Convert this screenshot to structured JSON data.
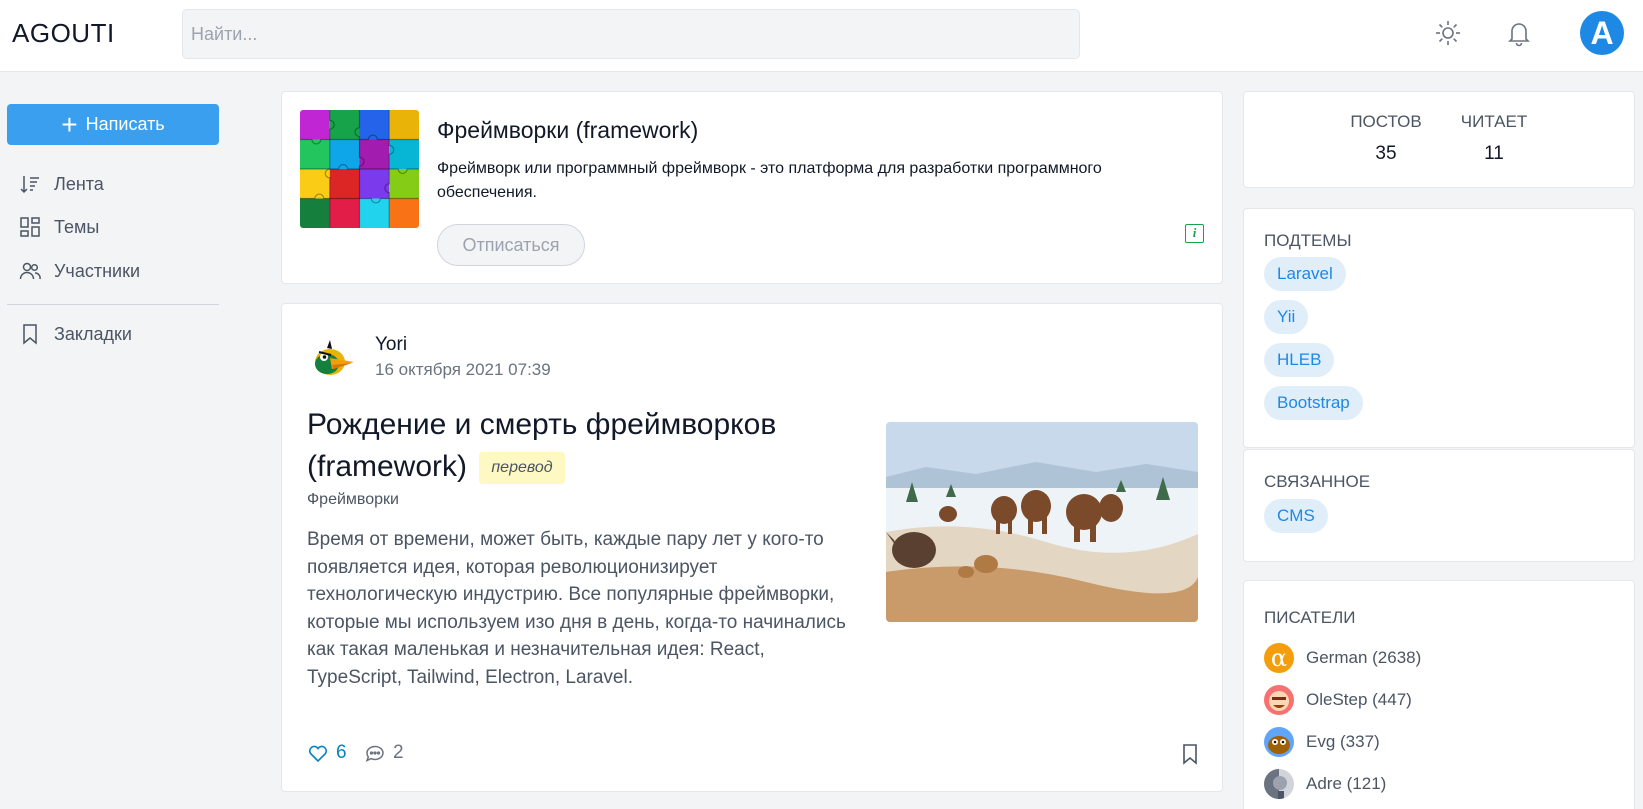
{
  "header": {
    "logo": "AGOUTI",
    "search_placeholder": "Найти...",
    "avatar_letter": "A",
    "brand_color": "#1e88e5"
  },
  "sidebar": {
    "write_label": "Написать",
    "items": [
      {
        "label": "Лента",
        "icon": "sort-icon"
      },
      {
        "label": "Темы",
        "icon": "grid-icon"
      },
      {
        "label": "Участники",
        "icon": "users-icon"
      },
      {
        "label": "Закладки",
        "icon": "bookmark-icon"
      }
    ]
  },
  "topic": {
    "title": "Фреймворки (framework)",
    "description": "Фреймворк или программный фреймворк - это платформа для разработки программного обеспечения.",
    "unsubscribe_label": "Отписаться",
    "info_glyph": "i"
  },
  "post": {
    "author": "Yori",
    "date": "16 октября 2021 07:39",
    "title": "Рождение и смерть фреймворков (framework)",
    "badge": "перевод",
    "topic": "Фреймворки",
    "body": "Время от времени, может быть, каждые пару лет у кого-то появляется идея, которая революционизирует технологическую индустрию. Все популярные фреймворки, которые мы используем изо дня в день, когда-то начинались как такая маленькая и незначительная идея: React, TypeScript, Tailwind, Electron, Laravel.",
    "likes": "6",
    "comments": "2"
  },
  "stats": {
    "posts_label": "ПОСТОВ",
    "posts_value": "35",
    "readers_label": "ЧИТАЕТ",
    "readers_value": "11"
  },
  "subtopics": {
    "title": "ПОДТЕМЫ",
    "items": [
      "Laravel",
      "Yii",
      "HLEB",
      "Bootstrap"
    ]
  },
  "related": {
    "title": "СВЯЗАННОЕ",
    "items": [
      "CMS"
    ]
  },
  "writers": {
    "title": "ПИСАТЕЛИ",
    "items": [
      {
        "name": "German (2638)"
      },
      {
        "name": "OleStep (447)"
      },
      {
        "name": "Evg (337)"
      },
      {
        "name": "Adre (121)"
      }
    ]
  }
}
